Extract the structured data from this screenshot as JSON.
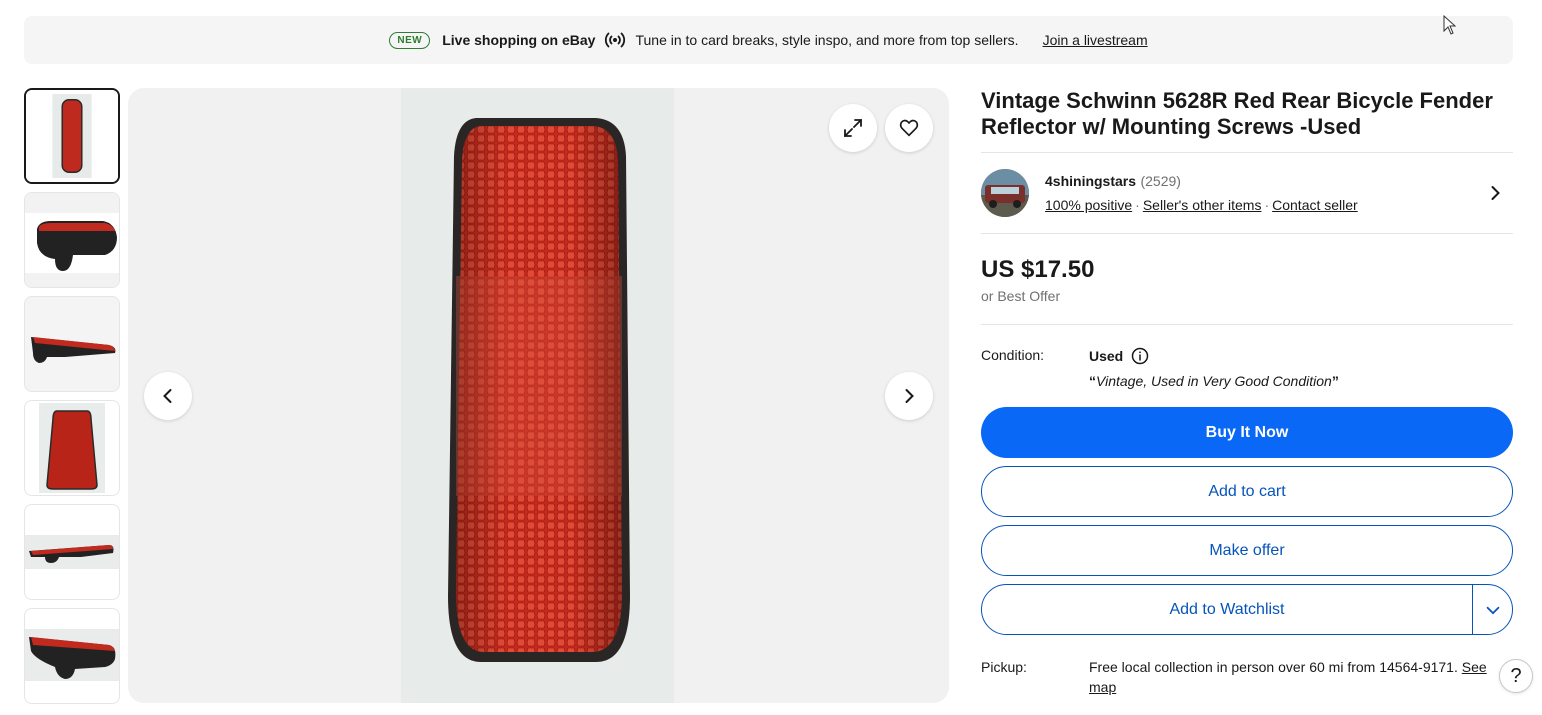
{
  "banner": {
    "badge": "NEW",
    "headline": "Live shopping on eBay",
    "text": "Tune in to card breaks, style inspo, and more from top sellers.",
    "link": "Join a livestream"
  },
  "gallery": {
    "thumbnail_count": 6,
    "active_index": 0
  },
  "item": {
    "title": "Vintage Schwinn 5628R Red Rear Bicycle Fender Reflector w/ Mounting Screws -Used"
  },
  "seller": {
    "name": "4shiningstars",
    "feedback_count": "(2529)",
    "positive": "100% positive",
    "other_items": "Seller's other items",
    "contact": "Contact seller"
  },
  "price": {
    "amount": "US $17.50",
    "best_offer": "or Best Offer"
  },
  "condition": {
    "label": "Condition:",
    "value": "Used",
    "open_quote": "“",
    "description": "Vintage, Used in Very Good Condition",
    "close_quote": "”"
  },
  "buttons": {
    "buy_now": "Buy It Now",
    "add_to_cart": "Add to cart",
    "make_offer": "Make offer",
    "add_to_watchlist": "Add to Watchlist"
  },
  "pickup": {
    "label": "Pickup:",
    "text": "Free local collection in person over 60 mi from 14564-9171.",
    "link": "See map"
  },
  "help": "?",
  "colors": {
    "primary_blue": "#0968f6",
    "link_blue": "#0654ba",
    "new_badge_green": "#2e7d32",
    "reflector_red": "#c8291c"
  }
}
